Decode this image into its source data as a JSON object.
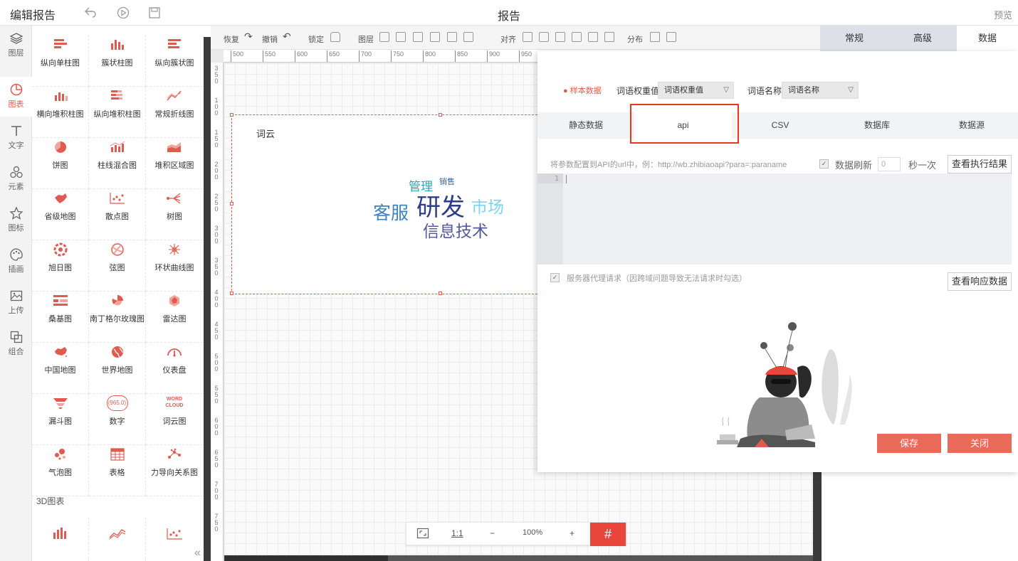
{
  "topbar": {
    "title": "编辑报告",
    "center_title": "报告",
    "preview": "预览"
  },
  "leftnav": [
    {
      "icon": "layers-icon",
      "label": "图层"
    },
    {
      "icon": "chart-icon",
      "label": "图表",
      "active": true
    },
    {
      "icon": "text-icon",
      "label": "文字"
    },
    {
      "icon": "elements-icon",
      "label": "元素"
    },
    {
      "icon": "star-icon",
      "label": "图标"
    },
    {
      "icon": "palette-icon",
      "label": "插画"
    },
    {
      "icon": "upload-icon",
      "label": "上传"
    },
    {
      "icon": "group-icon",
      "label": "组合"
    }
  ],
  "components": [
    "纵向单柱图",
    "簇状柱图",
    "纵向簇状图",
    "横向堆积柱图",
    "纵向堆积柱图",
    "常规折线图",
    "饼图",
    "柱线混合图",
    "堆积区域图",
    "省级地图",
    "散点图",
    "树图",
    "旭日图",
    "弦图",
    "环状曲线图",
    "桑基图",
    "南丁格尔玫瑰图",
    "雷达图",
    "中国地图",
    "世界地图",
    "仪表盘",
    "漏斗图",
    "数字",
    "词云图",
    "气泡图",
    "表格",
    "力导向关系图"
  ],
  "number_icon_text": "965.0",
  "wordcloud_icon_text": [
    "WORD",
    "CLOUD"
  ],
  "section_3d": "3D图表",
  "toolbar": {
    "redo": "恢复",
    "undo": "撤销",
    "lock": "锁定",
    "layer": "图层",
    "align": "对齐",
    "distribute": "分布"
  },
  "ruler_top": [
    "500",
    "550",
    "600",
    "650",
    "700",
    "750",
    "800",
    "850",
    "900",
    "950"
  ],
  "ruler_left": [
    "350",
    "100",
    "150",
    "200",
    "250",
    "300",
    "350",
    "400",
    "450",
    "500",
    "550",
    "600",
    "650",
    "700",
    "750"
  ],
  "widget": {
    "title": "词云",
    "words": [
      "管理",
      "销售",
      "客服",
      "研发",
      "市场",
      "信息技术"
    ]
  },
  "zoombar": {
    "ratio": "1:1",
    "minus": "−",
    "zoom": "100%",
    "plus": "+",
    "grid": "#"
  },
  "right_tabs": [
    "常规",
    "高级",
    "数据"
  ],
  "dialog": {
    "sample_data": "● 样本数据",
    "weight_label": "词语权重值",
    "weight_value": "词语权重值",
    "name_label": "词语名称",
    "name_value": "词语名称",
    "tabs": [
      "静态数据",
      "api",
      "CSV",
      "数据库",
      "数据源"
    ],
    "hint": "将参数配置到API的url中，例：http://wb.zhibiaoapi?para=:paraname",
    "refresh_label": "数据刷新",
    "refresh_value": "0",
    "per_second": "秒一次",
    "view_result": "查看执行结果",
    "line_number": "1",
    "proxy_label": "服务器代理请求（因跨域问题导致无法请求时勾选）",
    "view_response": "查看响应数据",
    "save": "保存",
    "close": "关闭"
  },
  "colors": {
    "accent": "#e05a4f",
    "highlight_box": "#e8391c",
    "button_red": "#ea6a5a"
  }
}
